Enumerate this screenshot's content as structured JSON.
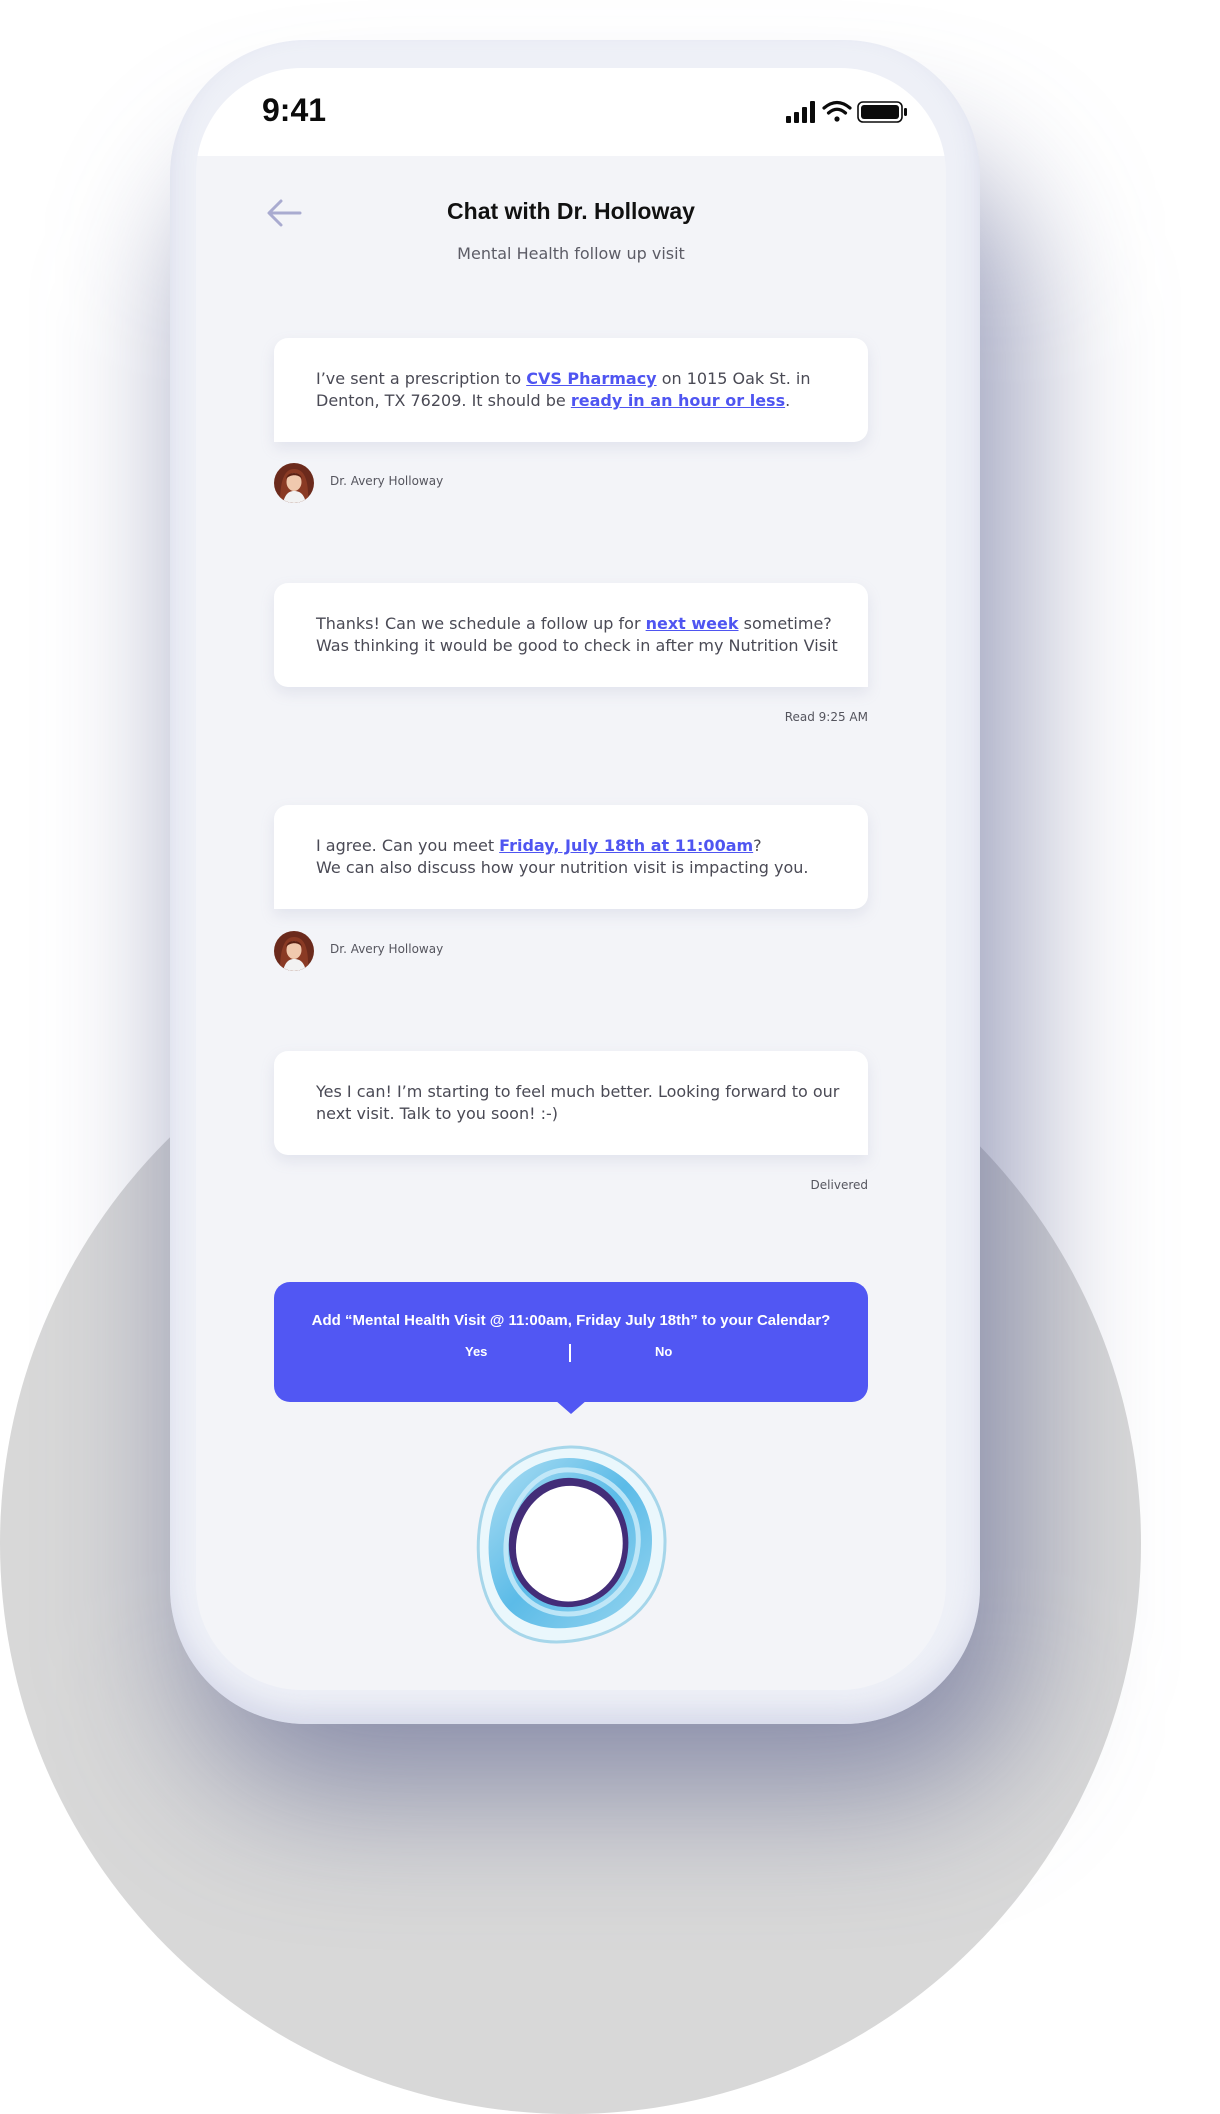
{
  "status_bar": {
    "time": "9:41"
  },
  "header": {
    "title": "Chat with Dr. Holloway",
    "subtitle": "Mental Health follow up visit"
  },
  "messages": [
    {
      "line1_before": "I’ve sent a prescription to ",
      "line1_link": "CVS Pharmacy",
      "line1_after": " on 1015 Oak St.  in",
      "line2_before": "Denton, TX 76209. It should be ",
      "line2_link": "ready in an hour or less",
      "line2_after": ".",
      "sender": "Dr. Avery Holloway"
    },
    {
      "line1_before": "Thanks! Can we schedule a follow up for ",
      "line1_link": "next week",
      "line1_after": " sometime?",
      "line2": "Was thinking it would be good to check in after my Nutrition Visit",
      "status": "Read 9:25 AM"
    },
    {
      "line1_before": "I agree. Can you meet ",
      "line1_link": "Friday, July 18th at 11:00am",
      "line1_after": "?",
      "line2": "We can also discuss how your nutrition visit is impacting you.",
      "sender": "Dr. Avery Holloway"
    },
    {
      "line1": "Yes I can! I’m starting to feel much better. Looking forward to our",
      "line2": "next visit. Talk to you soon! :-)",
      "status": "Delivered"
    }
  ],
  "calendar_prompt": {
    "text": "Add “Mental Health Visit @ 11:00am, Friday July 18th” to your Calendar?",
    "yes_label": "Yes",
    "no_label": "No"
  },
  "icons": {
    "back": "back-arrow-icon",
    "signal": "cellular-signal-icon",
    "wifi": "wifi-icon",
    "battery": "battery-icon",
    "assistant": "voice-assistant-orb-icon"
  },
  "colors": {
    "accent": "#5157f3",
    "link": "#4f55f1",
    "screen_background": "#f3f4f8"
  }
}
